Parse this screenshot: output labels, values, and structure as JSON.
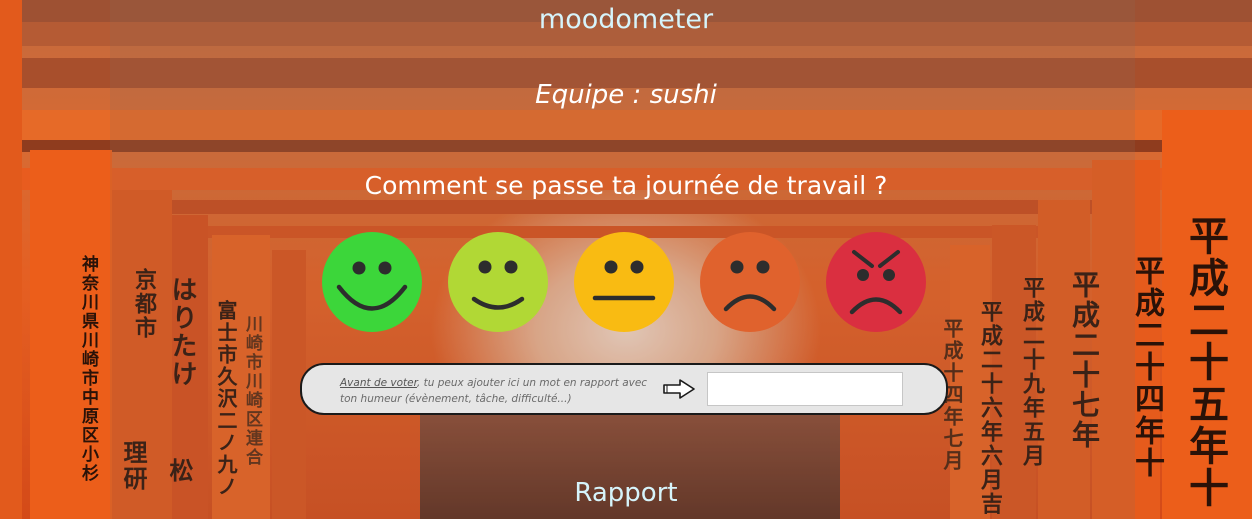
{
  "app": {
    "title": "moodometer",
    "team_line": "Equipe : sushi"
  },
  "vote": {
    "question": "Comment se passe ta journée de travail ?",
    "moods": [
      {
        "name": "very-happy",
        "color": "#3cd63a"
      },
      {
        "name": "happy",
        "color": "#b1d835"
      },
      {
        "name": "neutral",
        "color": "#f9bb12"
      },
      {
        "name": "sad",
        "color": "#e0622d"
      },
      {
        "name": "angry",
        "color": "#da2f40"
      }
    ]
  },
  "comment": {
    "link_text": "Avant de voter",
    "hint_text": ", tu peux ajouter ici un mot en rapport avec ton humeur (évènement, tâche, difficulté...)",
    "input_value": "",
    "icon": "right-arrow-icon"
  },
  "footer": {
    "report_label": "Rapport"
  },
  "background": {
    "kanji_left_1": "神奈川県川崎市中原区小杉",
    "kanji_left_2": "京都市",
    "kanji_left_3": "理研",
    "kanji_left_4": "はりたけ",
    "kanji_left_5": "松",
    "kanji_left_6": "富士市久沢二ノ九ノ",
    "kanji_left_7": "川崎市川崎区連合",
    "kanji_right_1": "平成二十五年十",
    "kanji_right_2": "平成二十四年十",
    "kanji_right_3": "平成二十七年",
    "kanji_right_4": "平成二十九年五月",
    "kanji_right_5": "平成二十六年六月吉",
    "kanji_right_6": "平成十四年七月"
  }
}
